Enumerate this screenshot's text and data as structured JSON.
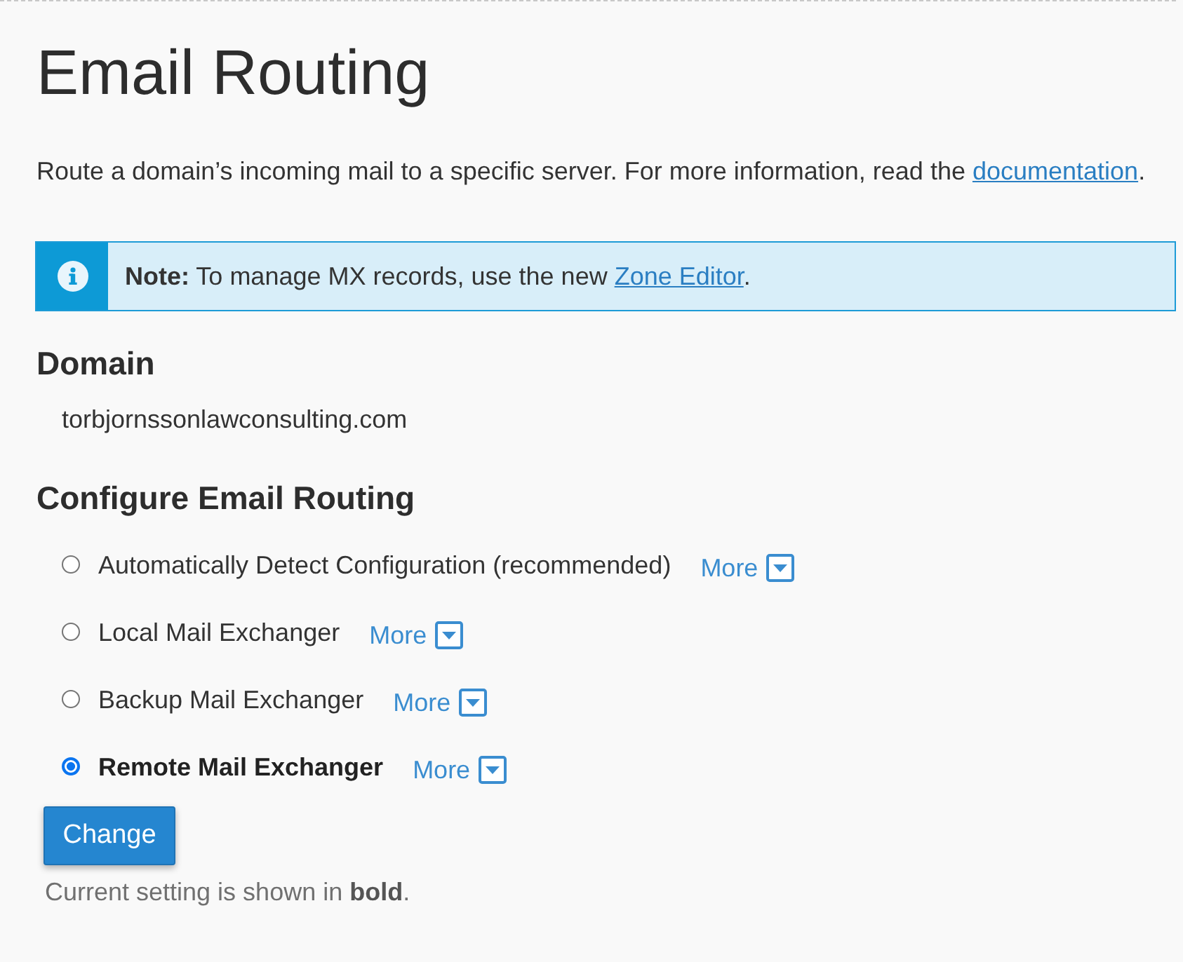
{
  "title": "Email Routing",
  "intro": {
    "text": "Route a domain’s incoming mail to a specific server. For more information, read the ",
    "link": "documentation",
    "end": "."
  },
  "alert": {
    "text": "**Note:** To manage MX records, use the new ",
    "link": "Zone Editor",
    "end": "."
  },
  "domain": {
    "heading": "Domain",
    "value": "torbjornssonlawconsulting.com"
  },
  "routing": {
    "heading": "Configure Email Routing",
    "options": [
      {
        "label": "Automatically Detect Configuration (recommended)",
        "selected": false,
        "current": false,
        "more": "More"
      },
      {
        "label": "Local Mail Exchanger",
        "selected": false,
        "current": false,
        "more": "More"
      },
      {
        "label": "Backup Mail Exchanger",
        "selected": false,
        "current": false,
        "more": "More"
      },
      {
        "label": "Remote Mail Exchanger",
        "selected": true,
        "current": true,
        "more": "More"
      }
    ]
  },
  "button": "Change",
  "footnote": "Current setting is shown in **bold**."
}
